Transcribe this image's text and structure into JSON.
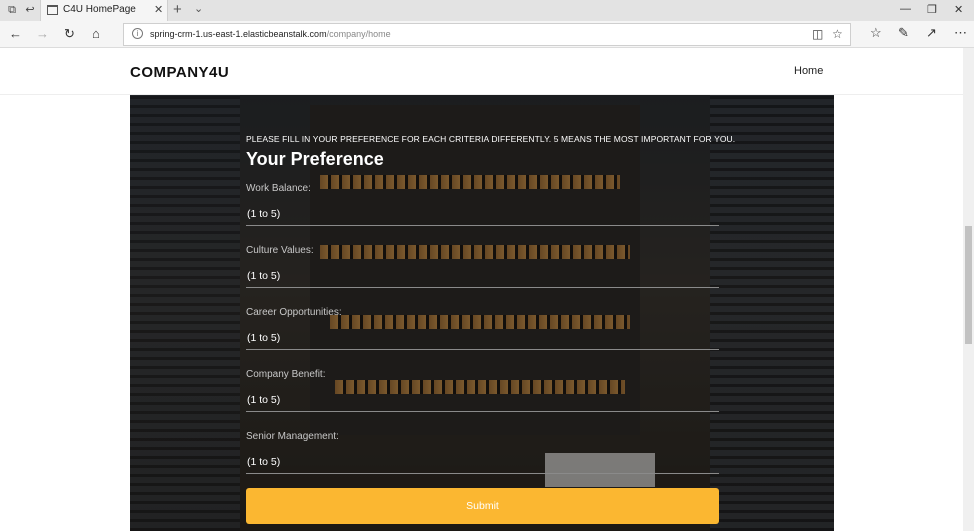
{
  "browser": {
    "tab_title": "C4U HomePage",
    "url_host": "spring-crm-1.us-east-1.elasticbeanstalk.com",
    "url_path": "/company/home",
    "icons": [
      "back-icon",
      "forward-icon",
      "refresh-icon",
      "home-icon",
      "reading-view-icon",
      "favorite-star-icon",
      "favorites-hub-icon",
      "pen-icon",
      "share-icon",
      "more-icon"
    ]
  },
  "header": {
    "brand": "COMPANY4U",
    "nav_home": "Home"
  },
  "form": {
    "instruction": "PLEASE FILL IN YOUR PREFERENCE FOR EACH CRITERIA DIFFERENTLY. 5 MEANS THE MOST IMPORTANT FOR YOU.",
    "title": "Your Preference",
    "fields": [
      {
        "label": "Work Balance:",
        "placeholder": "(1 to 5)"
      },
      {
        "label": "Culture Values:",
        "placeholder": "(1 to 5)"
      },
      {
        "label": "Career Opportunities:",
        "placeholder": "(1 to 5)"
      },
      {
        "label": "Company Benefit:",
        "placeholder": "(1 to 5)"
      },
      {
        "label": "Senior Management:",
        "placeholder": "(1 to 5)"
      }
    ],
    "submit_label": "Submit"
  },
  "colors": {
    "accent": "#fbb731",
    "brand_text": "#111111"
  }
}
